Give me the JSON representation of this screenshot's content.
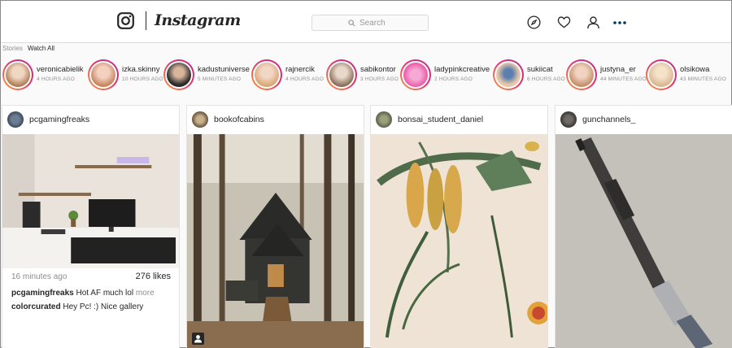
{
  "app": {
    "brand": "Instagram",
    "accent": "#e1306c",
    "border": "#dbdbdb"
  },
  "header": {
    "search_placeholder": "Search",
    "icons": [
      "instagram-logo-icon",
      "search-icon",
      "explore-compass-icon",
      "heart-icon",
      "profile-icon",
      "more-dots-icon"
    ]
  },
  "stories": {
    "label": "Stories",
    "watch_all": "Watch All",
    "items": [
      {
        "name": "veronicabielik",
        "time": "4 HOURS AGO"
      },
      {
        "name": "izka.skinny",
        "time": "10 HOURS AGO"
      },
      {
        "name": "kadustuniverse",
        "time": "5 MINUTES AGO"
      },
      {
        "name": "rajnercik",
        "time": "4 HOURS AGO"
      },
      {
        "name": "sabikontor",
        "time": "3 HOURS AGO"
      },
      {
        "name": "ladypinkcreative",
        "time": "2 HOURS AGO"
      },
      {
        "name": "sukiicat",
        "time": "6 HOURS AGO"
      },
      {
        "name": "justyna_er",
        "time": "44 MINUTES AGO"
      },
      {
        "name": "olsikowa",
        "time": "43 MINUTES AGO"
      }
    ]
  },
  "posts": [
    {
      "user": "pcgamingfreaks",
      "time": "16 minutes ago",
      "likes": "276 likes",
      "comments": [
        {
          "user": "pcgamingfreaks",
          "text": " Hot AF much lol ",
          "more": "more"
        },
        {
          "user": "colorcurated",
          "text": " Hey Pc! :) Nice gallery"
        }
      ]
    },
    {
      "user": "bookofcabins"
    },
    {
      "user": "bonsai_student_daniel"
    },
    {
      "user": "gunchannels_"
    }
  ]
}
